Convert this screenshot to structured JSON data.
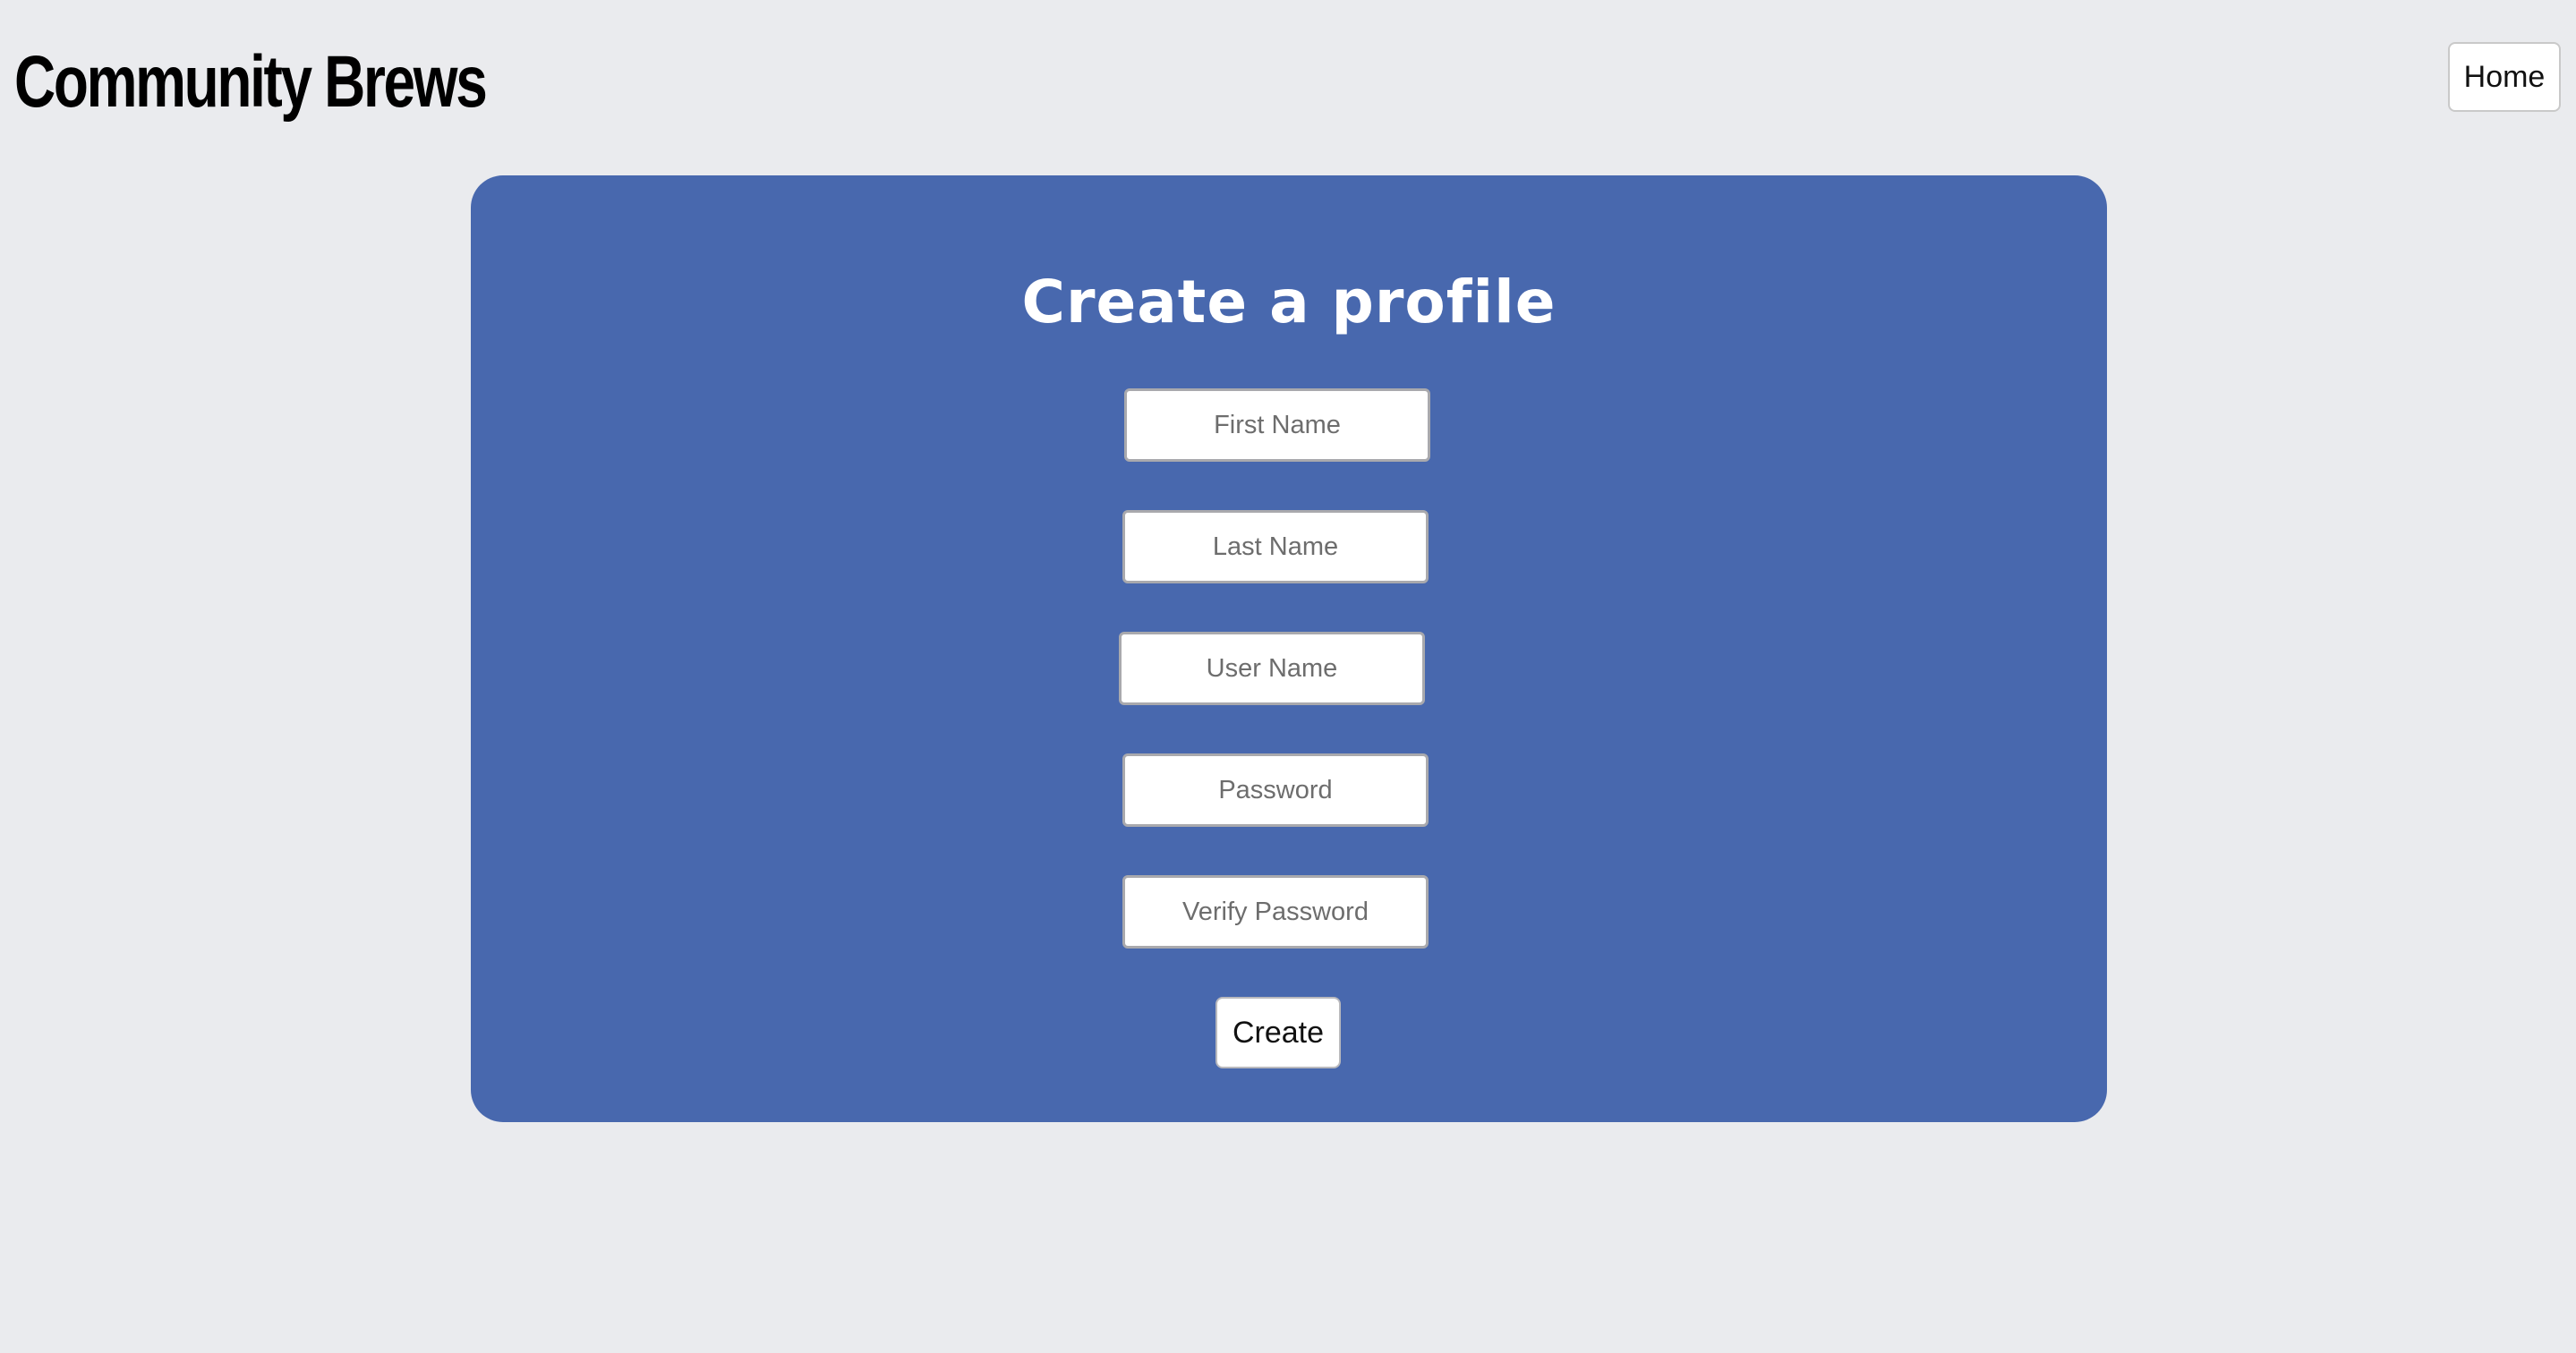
{
  "header": {
    "site_title": "Community Brews",
    "home_label": "Home"
  },
  "form": {
    "heading": "Create a profile",
    "fields": [
      {
        "name": "first-name",
        "placeholder": "First Name",
        "value": ""
      },
      {
        "name": "last-name",
        "placeholder": "Last Name",
        "value": ""
      },
      {
        "name": "user-name",
        "placeholder": "User Name",
        "value": ""
      },
      {
        "name": "password",
        "placeholder": "Password",
        "value": ""
      },
      {
        "name": "verify-password",
        "placeholder": "Verify Password",
        "value": ""
      }
    ],
    "submit_label": "Create"
  },
  "colors": {
    "page_background": "#eaebee",
    "card_background": "#4868ae",
    "heading_text": "#ffffff",
    "title_text": "#000000"
  }
}
